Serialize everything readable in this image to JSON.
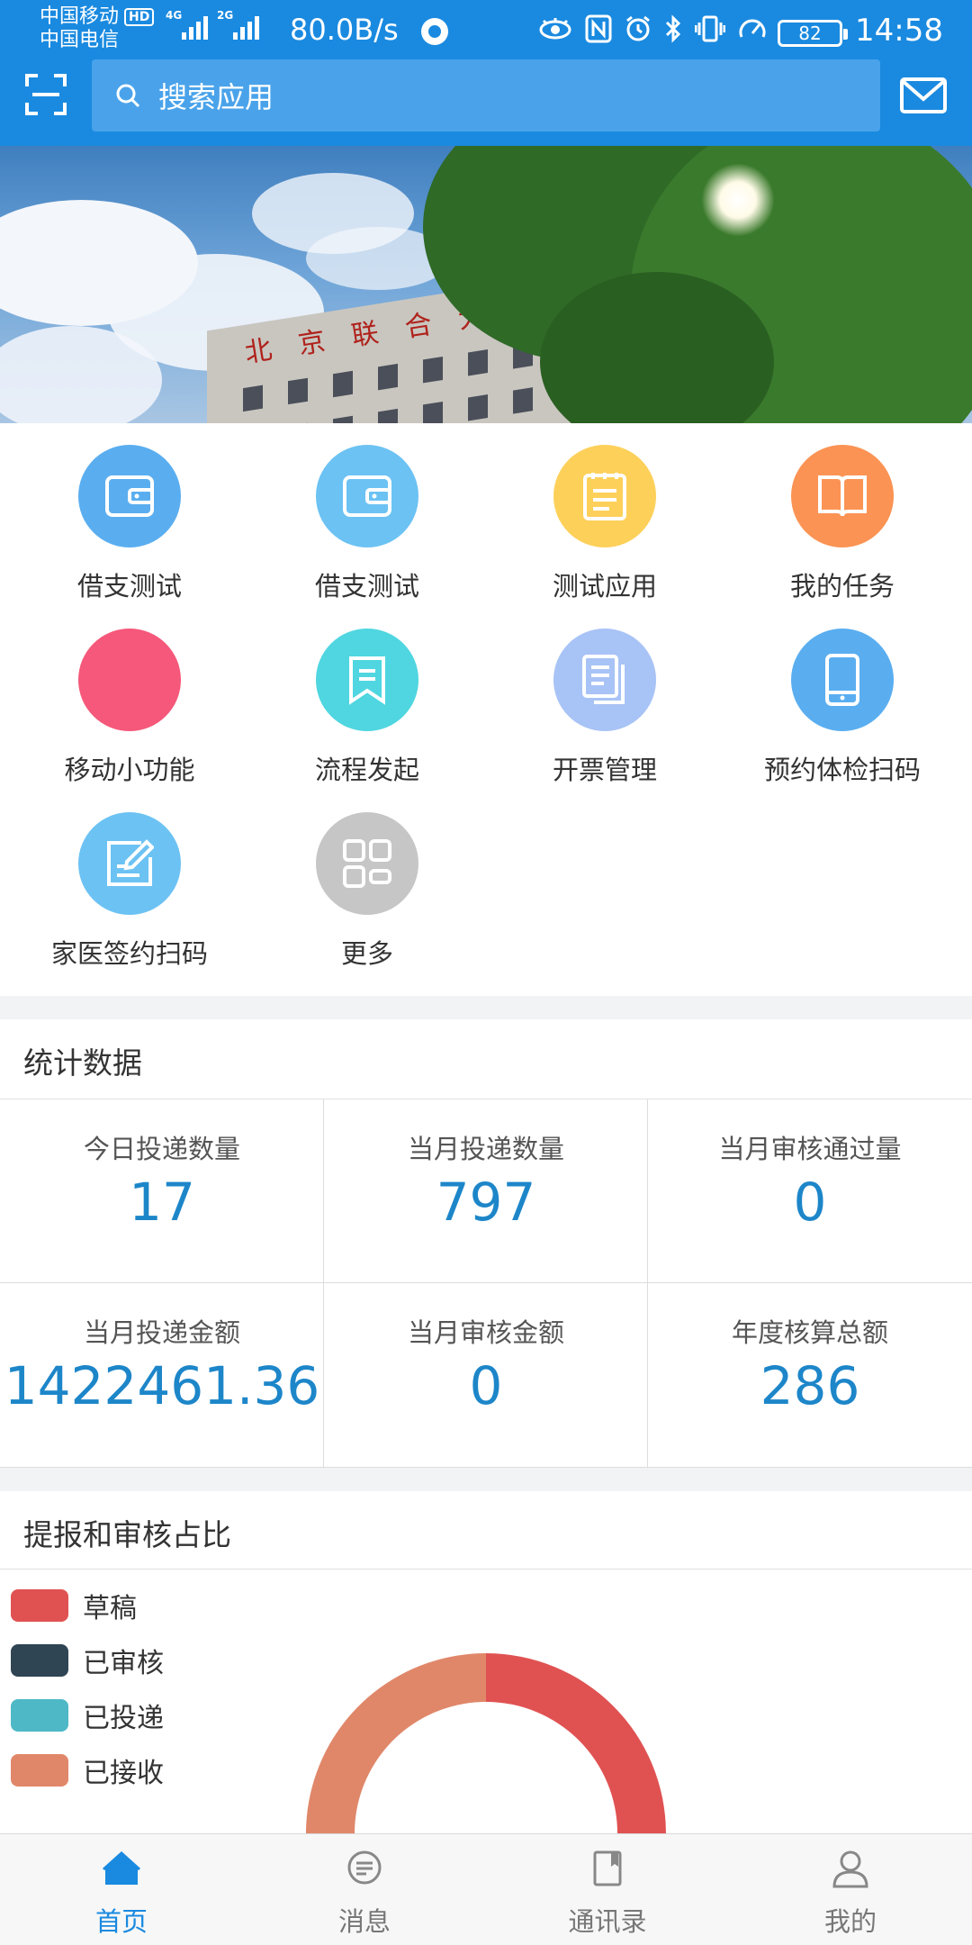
{
  "status_bar": {
    "carrier1": "中国移动",
    "hd": "HD",
    "carrier2": "中国电信",
    "signal1_label": "4G",
    "signal2_label": "2G",
    "net_speed": "80.0B/s",
    "battery": "82",
    "time": "14:58"
  },
  "header": {
    "search_placeholder": "搜索应用"
  },
  "banner": {
    "sign_text": "北京联合大",
    "page_count": 2,
    "active_page": 2
  },
  "apps": [
    {
      "label": "借支测试",
      "icon": "wallet-icon",
      "color": "#5aaef0"
    },
    {
      "label": "借支测试",
      "icon": "wallet-icon",
      "color": "#6cc2f3"
    },
    {
      "label": "测试应用",
      "icon": "notepad-icon",
      "color": "#fdd05a"
    },
    {
      "label": "我的任务",
      "icon": "book-icon",
      "color": "#fb9354"
    },
    {
      "label": "移动小功能",
      "icon": "none",
      "color": "#f5587a"
    },
    {
      "label": "流程发起",
      "icon": "bookmark-icon",
      "color": "#4fd6e0"
    },
    {
      "label": "开票管理",
      "icon": "documents-icon",
      "color": "#a8c3f6"
    },
    {
      "label": "预约体检扫码",
      "icon": "phone-icon",
      "color": "#5aaef0"
    },
    {
      "label": "家医签约扫码",
      "icon": "edit-icon",
      "color": "#6cc2f3"
    },
    {
      "label": "更多",
      "icon": "grid-icon",
      "color": "#c6c6c6"
    }
  ],
  "stats": {
    "title": "统计数据",
    "items": [
      {
        "label": "今日投递数量",
        "value": "17"
      },
      {
        "label": "当月投递数量",
        "value": "797"
      },
      {
        "label": "当月审核通过量",
        "value": "0"
      },
      {
        "label": "当月投递金额",
        "value": "1422461.36"
      },
      {
        "label": "当月审核金额",
        "value": "0"
      },
      {
        "label": "年度核算总额",
        "value": "286"
      }
    ]
  },
  "ratio": {
    "title": "提报和审核占比",
    "legend": [
      {
        "label": "草稿",
        "color": "#e05252"
      },
      {
        "label": "已审核",
        "color": "#2f4553"
      },
      {
        "label": "已投递",
        "color": "#4fb8c6"
      },
      {
        "label": "已接收",
        "color": "#e0876a"
      }
    ]
  },
  "chart_data": {
    "type": "pie",
    "title": "提报和审核占比",
    "categories": [
      "草稿",
      "已审核",
      "已投递",
      "已接收"
    ],
    "values": [
      50,
      0,
      7,
      43
    ],
    "colors": [
      "#e05252",
      "#2f4553",
      "#4fb8c6",
      "#e0876a"
    ],
    "legend_position": "top-left"
  },
  "nav": [
    {
      "label": "首页",
      "icon": "home-icon",
      "active": true
    },
    {
      "label": "消息",
      "icon": "message-icon",
      "active": false
    },
    {
      "label": "通讯录",
      "icon": "contacts-icon",
      "active": false
    },
    {
      "label": "我的",
      "icon": "user-icon",
      "active": false
    }
  ],
  "colors": {
    "primary": "#1a8ae0",
    "stat_value": "#1d86c9"
  }
}
